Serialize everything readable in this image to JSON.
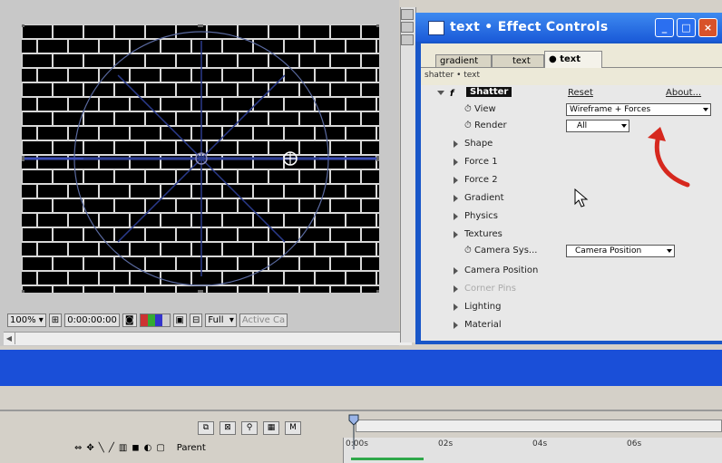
{
  "viewer": {
    "zoom": "100%",
    "timecode": "0:00:00:00",
    "resolution": "Full",
    "active_camera": "Active Ca"
  },
  "effect_controls": {
    "title": "text • Effect Controls",
    "tabs": [
      "gradient",
      "text",
      "text"
    ],
    "active_tab_index": 2,
    "breadcrumb": "shatter • text",
    "effect_name": "Shatter",
    "fx_label": "f",
    "reset_label": "Reset",
    "about_label": "About...",
    "view_label": "View",
    "view_value": "Wireframe + Forces",
    "render_label": "Render",
    "render_value": "All",
    "groups": [
      "Shape",
      "Force 1",
      "Force 2",
      "Gradient",
      "Physics",
      "Textures"
    ],
    "camera_system_label": "Camera Sys...",
    "camera_system_value": "Camera Position",
    "groups_after": [
      "Camera Position",
      "Corner Pins",
      "Lighting",
      "Material"
    ]
  },
  "timeline": {
    "controls": [
      "⧉",
      "⊠",
      "⚲",
      "▦",
      "M"
    ],
    "tools": [
      "⇔",
      "✥",
      "╲",
      "╱",
      "▥",
      "◼",
      "◐",
      "▢"
    ],
    "parent_label": "Parent",
    "ruler_ticks": [
      "0:00s",
      "02s",
      "04s",
      "06s"
    ]
  },
  "colors": {
    "annotation": "#d6281e",
    "wireframe": "#3e4fb8",
    "brick_mortar": "#d8d8d8"
  }
}
